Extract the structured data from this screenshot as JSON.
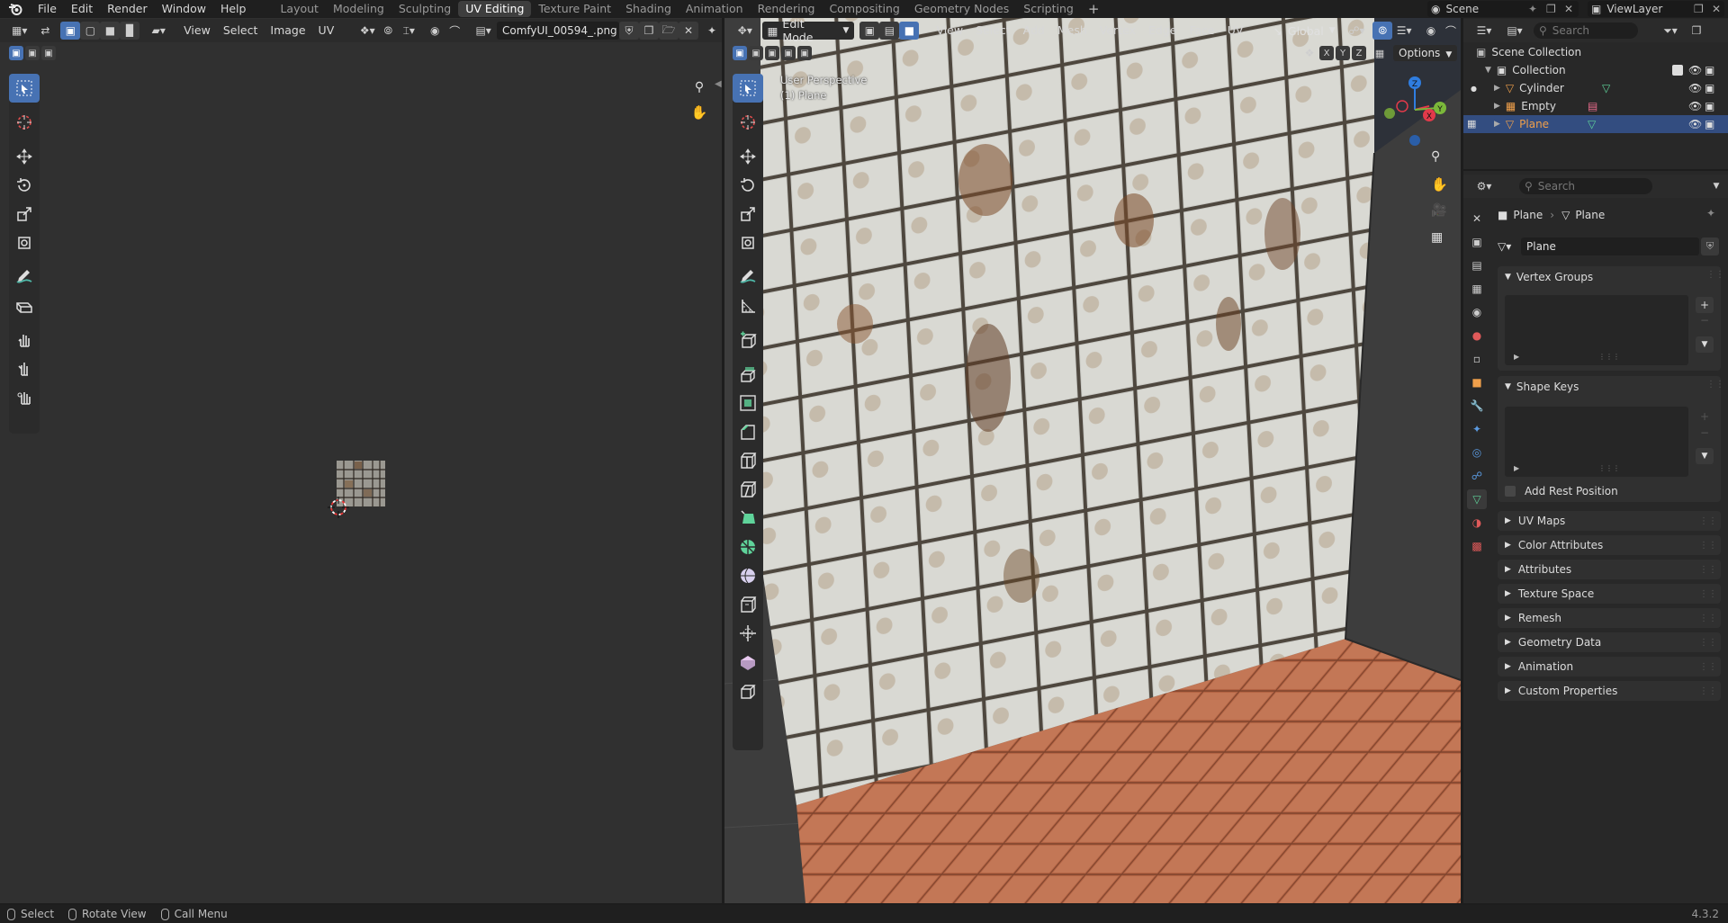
{
  "app_menu": [
    "File",
    "Edit",
    "Render",
    "Window",
    "Help"
  ],
  "workspaces": [
    {
      "label": "Layout",
      "active": false
    },
    {
      "label": "Modeling",
      "active": false
    },
    {
      "label": "Sculpting",
      "active": false
    },
    {
      "label": "UV Editing",
      "active": true
    },
    {
      "label": "Texture Paint",
      "active": false
    },
    {
      "label": "Shading",
      "active": false
    },
    {
      "label": "Animation",
      "active": false
    },
    {
      "label": "Rendering",
      "active": false
    },
    {
      "label": "Compositing",
      "active": false
    },
    {
      "label": "Geometry Nodes",
      "active": false
    },
    {
      "label": "Scripting",
      "active": false
    }
  ],
  "scene": {
    "name": "Scene",
    "view_layer": "ViewLayer"
  },
  "uv_editor": {
    "menus": [
      "View",
      "Select",
      "Image",
      "UV"
    ],
    "image_name": "ComfyUI_00594_.png"
  },
  "viewport": {
    "mode": "Edit Mode",
    "menus": [
      "View",
      "Select",
      "Add",
      "Mesh",
      "Vertex",
      "Edge",
      "Face",
      "UV"
    ],
    "orientation": "Global",
    "axes": [
      "X",
      "Y",
      "Z"
    ],
    "options_label": "Options",
    "overlay_title": "User Perspective",
    "overlay_object": "(1) Plane",
    "gizmo": {
      "x": "X",
      "y": "Y",
      "z": "Z"
    }
  },
  "outliner": {
    "search_placeholder": "Search",
    "root": "Scene Collection",
    "collection": "Collection",
    "items": [
      {
        "name": "Cylinder",
        "selected": false
      },
      {
        "name": "Empty",
        "selected": false
      },
      {
        "name": "Plane",
        "selected": true
      }
    ]
  },
  "properties": {
    "search_placeholder": "Search",
    "breadcrumb_object": "Plane",
    "breadcrumb_data": "Plane",
    "mesh_name": "Plane",
    "vertex_groups": "Vertex Groups",
    "shape_keys": "Shape Keys",
    "add_rest_position": "Add Rest Position",
    "collapsed": [
      "UV Maps",
      "Color Attributes",
      "Attributes",
      "Texture Space",
      "Remesh",
      "Geometry Data",
      "Animation",
      "Custom Properties"
    ]
  },
  "status_bar": {
    "select": "Select",
    "rotate": "Rotate View",
    "menu": "Call Menu",
    "version": "4.3.2"
  },
  "colors": {
    "accent": "#4772b3",
    "active_orange": "#f0a04b",
    "mesh_green": "#5fd39a"
  }
}
